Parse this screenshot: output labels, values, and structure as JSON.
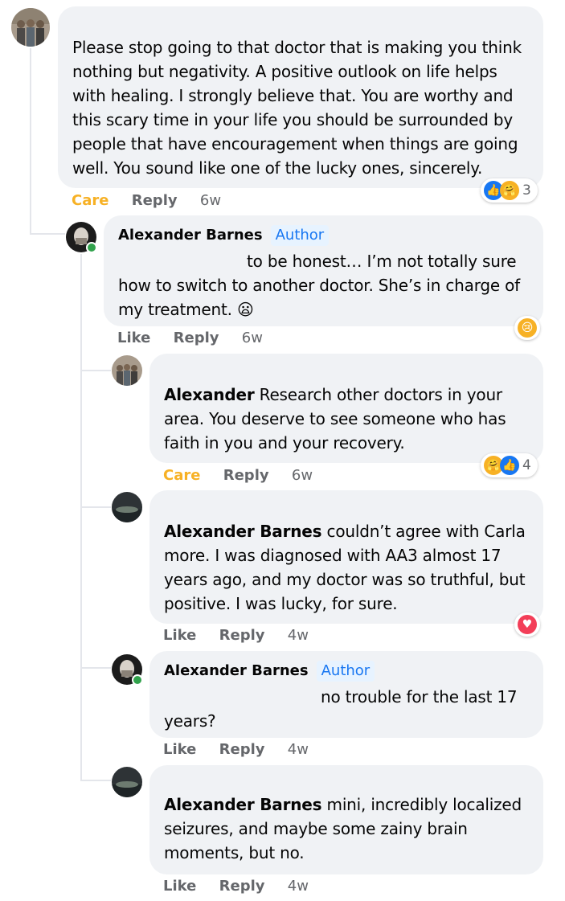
{
  "comments": [
    {
      "text": "Please stop going to that doctor that is making you think nothing but negativity. A positive outlook on life helps with healing. I strongly believe that. You are worthy and this scary time in your life you should be surrounded by people that have encouragement when things are going well. You sound like one of the lucky ones, sincerely.",
      "action1": "Care",
      "reply": "Reply",
      "time": "6w",
      "reaction_count": "3"
    },
    {
      "name": "Alexander Barnes",
      "badge": "Author",
      "text": "to be honest… I’m not totally sure how to switch to another doctor. She’s in charge of my treatment.",
      "emoji": "😦",
      "action1": "Like",
      "reply": "Reply",
      "time": "6w"
    },
    {
      "name": "Alexander",
      "text": "Research other doctors in your area. You deserve to see someone who has faith in you and your recovery.",
      "action1": "Care",
      "reply": "Reply",
      "time": "6w",
      "reaction_count": "4"
    },
    {
      "name": "Alexander Barnes",
      "text": "couldn’t agree with Carla more. I was diagnosed with AA3 almost 17 years ago, and my doctor was so truthful, but positive. I was lucky, for sure.",
      "action1": "Like",
      "reply": "Reply",
      "time": "4w"
    },
    {
      "name": "Alexander Barnes",
      "badge": "Author",
      "text": "no trouble for the last 17 years?",
      "action1": "Like",
      "reply": "Reply",
      "time": "4w"
    },
    {
      "name": "Alexander Barnes",
      "text": "mini, incredibly localized seizures, and maybe some zainy brain moments, but no.",
      "action1": "Like",
      "reply": "Reply",
      "time": "4w"
    }
  ],
  "icons": {
    "like": "like-icon",
    "care": "care-icon",
    "sad": "sad-icon",
    "love": "love-icon"
  },
  "colors": {
    "care": "#f7b125",
    "link": "#1877f2",
    "bubble": "#f0f2f5",
    "online": "#31a24c"
  }
}
